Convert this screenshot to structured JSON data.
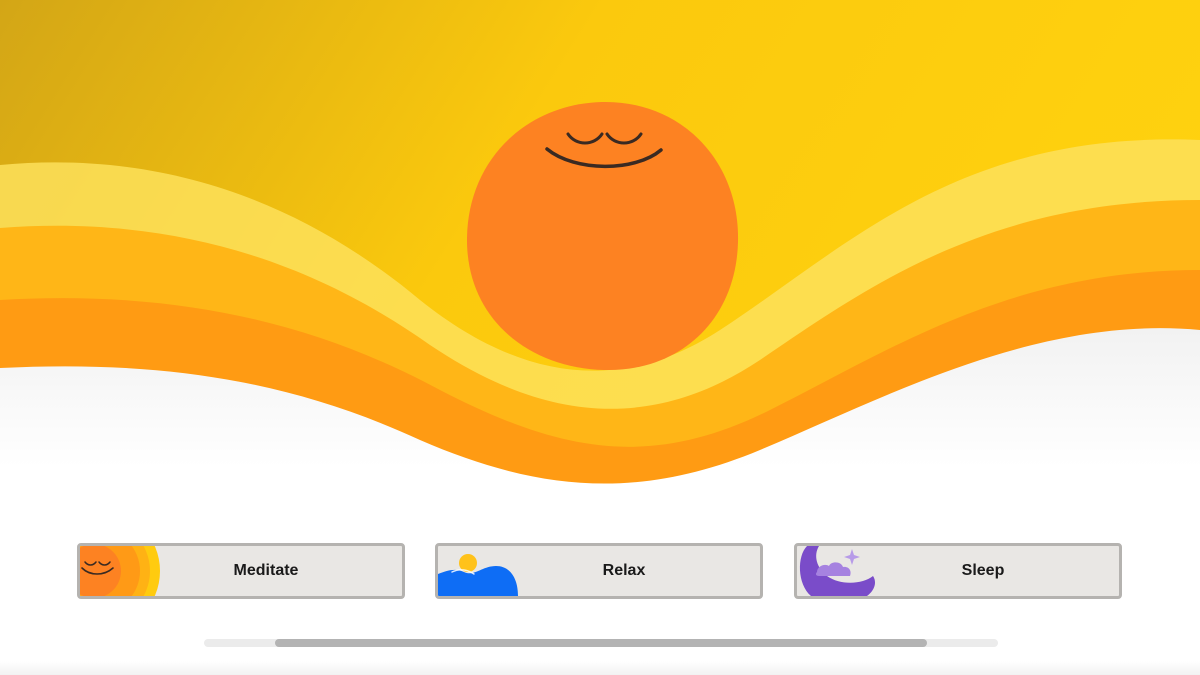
{
  "hero": {
    "illustration": "smiling-sun-over-waves",
    "colors": {
      "sky_left": "#d4a714",
      "sky_right": "#ffd11a",
      "wave_pale": "#fde15a",
      "wave_mid": "#ffb516",
      "wave_deep": "#ff9a12",
      "sun": "#fd8222",
      "face": "#3a2a22"
    }
  },
  "categories": [
    {
      "label": "Meditate",
      "icon": "meditate-sun-icon"
    },
    {
      "label": "Relax",
      "icon": "relax-waves-icon"
    },
    {
      "label": "Sleep",
      "icon": "sleep-moon-icon"
    }
  ],
  "scrollbar": {
    "visible_fraction": 0.82,
    "position_fraction": 0.5
  }
}
